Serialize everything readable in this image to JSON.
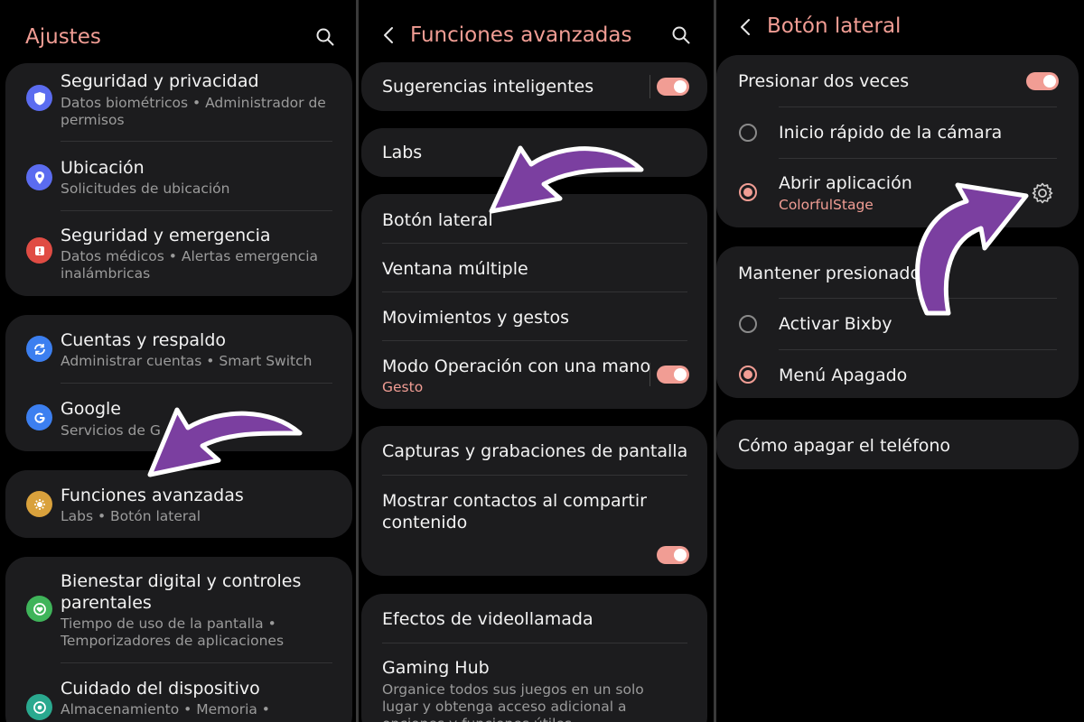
{
  "panel1": {
    "title": "Ajustes",
    "items": [
      {
        "title": "Seguridad y privacidad",
        "subtitle": "Datos biométricos • Administrador de permisos",
        "icon": "shield-icon",
        "color": "#5b6cf0"
      },
      {
        "title": "Ubicación",
        "subtitle": "Solicitudes de ubicación",
        "icon": "location-icon",
        "color": "#5b6cf0"
      },
      {
        "title": "Seguridad y emergencia",
        "subtitle": "Datos médicos • Alertas emergencia inalámbricas",
        "icon": "emergency-icon",
        "color": "#e04c44"
      },
      {
        "title": "Cuentas y respaldo",
        "subtitle": "Administrar cuentas • Smart Switch",
        "icon": "sync-icon",
        "color": "#3c7ff0"
      },
      {
        "title": "Google",
        "subtitle": "Servicios de G",
        "icon": "google-icon",
        "color": "#3c7ff0"
      },
      {
        "title": "Funciones avanzadas",
        "subtitle": "Labs • Botón lateral",
        "icon": "advanced-features-icon",
        "color": "#d9a13c"
      },
      {
        "title": "Bienestar digital y controles parentales",
        "subtitle": "Tiempo de uso de la pantalla • Temporizadores de aplicaciones",
        "icon": "wellbeing-icon",
        "color": "#3fb45a"
      },
      {
        "title": "Cuidado del dispositivo",
        "subtitle": "Almacenamiento • Memoria •",
        "icon": "device-care-icon",
        "color": "#2aa98f"
      }
    ]
  },
  "panel2": {
    "title": "Funciones avanzadas",
    "items": {
      "sugerencias": "Sugerencias inteligentes",
      "labs": "Labs",
      "boton_lateral": "Botón lateral",
      "ventana": "Ventana múltiple",
      "movimientos": "Movimientos y gestos",
      "modo_una_mano": "Modo Operación con una mano",
      "modo_una_mano_sub": "Gesto",
      "capturas": "Capturas y grabaciones de pantalla",
      "mostrar_contactos": "Mostrar contactos al compartir contenido",
      "efectos": "Efectos de videollamada",
      "gaming": "Gaming Hub",
      "gaming_sub": "Organice todos sus juegos en un solo lugar y obtenga acceso adicional a opciones y funciones útiles..."
    },
    "toggles": {
      "sugerencias": true,
      "modo_una_mano": true,
      "mostrar_contactos": true
    }
  },
  "panel3": {
    "title": "Botón lateral",
    "presionar_dos_veces": "Presionar dos veces",
    "inicio_rapido": "Inicio rápido de la cámara",
    "abrir_app": "Abrir aplicación",
    "abrir_app_sub": "ColorfulStage",
    "mantener": "Mantener presionado",
    "activar_bixby": "Activar Bixby",
    "menu_apagado": "Menú Apagado",
    "como_apagar": "Cómo apagar el teléfono",
    "selected_double_press": "Abrir aplicación",
    "selected_hold": "Menú Apagado"
  },
  "colors": {
    "accent": "#f19d94",
    "card": "#1c1c1e",
    "arrow": "#7b3fa0"
  }
}
